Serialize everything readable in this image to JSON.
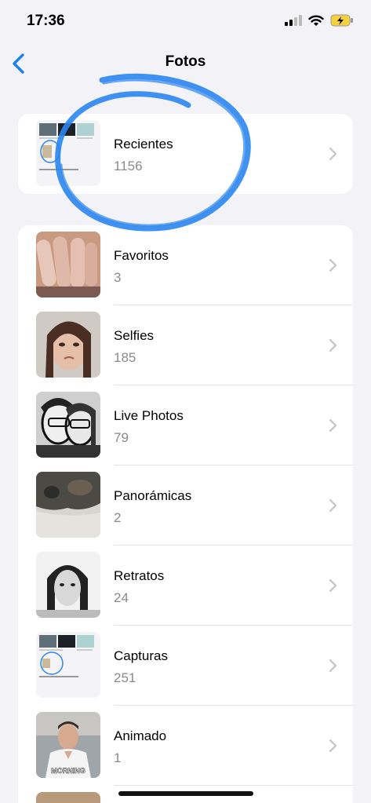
{
  "status_bar": {
    "time": "17:36"
  },
  "nav": {
    "title": "Fotos"
  },
  "recents": {
    "title": "Recientes",
    "count": "1156"
  },
  "albums": [
    {
      "title": "Favoritos",
      "count": "3"
    },
    {
      "title": "Selfies",
      "count": "185"
    },
    {
      "title": "Live Photos",
      "count": "79"
    },
    {
      "title": "Panorámicas",
      "count": "2"
    },
    {
      "title": "Retratos",
      "count": "24"
    },
    {
      "title": "Capturas",
      "count": "251"
    },
    {
      "title": "Animado",
      "count": "1"
    }
  ],
  "animado_caption": "MORNING",
  "colors": {
    "accent": "#1e7ff0",
    "annotation": "#2b86f0"
  }
}
